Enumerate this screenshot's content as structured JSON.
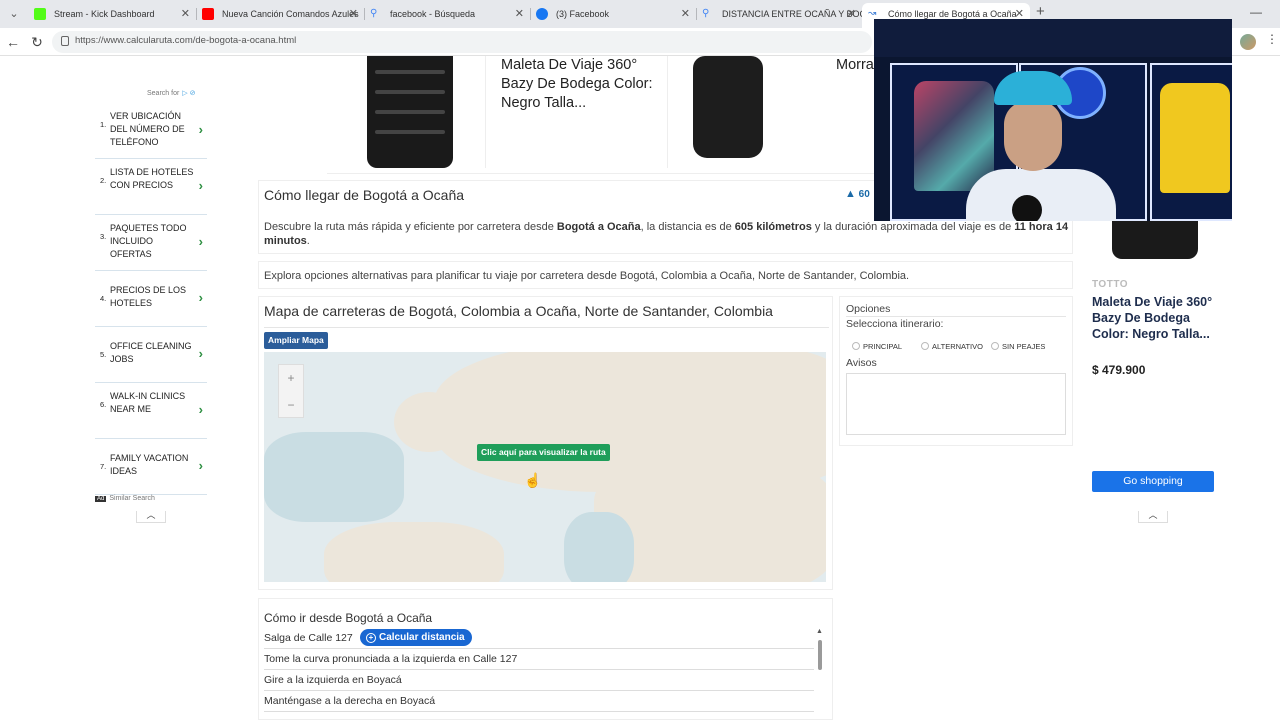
{
  "browser": {
    "tabs": [
      {
        "title": "Stream - Kick Dashboard",
        "icon_color": "#53fc18",
        "active": false
      },
      {
        "title": "Nueva Canción Comandos Azules",
        "icon_color": "#ff0000",
        "active": false
      },
      {
        "title": "facebook - Búsqueda",
        "icon_color": "#4285f4",
        "active": false
      },
      {
        "title": "(3) Facebook",
        "icon_color": "#1877f2",
        "active": false
      },
      {
        "title": "DISTANCIA ENTRE OCAÑA Y BOGOTÁ",
        "icon_color": "#4285f4",
        "active": false
      },
      {
        "title": "Cómo llegar de Bogotá a Ocaña",
        "icon_color": "#3a7bd5",
        "active": true
      }
    ],
    "url": "https://www.calcularuta.com/de-bogota-a-ocana.html"
  },
  "left_ad": {
    "search_for": "Search for",
    "items": [
      {
        "num": "1.",
        "label": "Ver ubicación del número de teléfono"
      },
      {
        "num": "2.",
        "label": "Lista de hoteles con precios"
      },
      {
        "num": "3.",
        "label": "Paquetes todo incluido ofertas"
      },
      {
        "num": "4.",
        "label": "Precios de los hoteles"
      },
      {
        "num": "5.",
        "label": "Office cleaning jobs"
      },
      {
        "num": "6.",
        "label": "Walk-in clinics near me"
      },
      {
        "num": "7.",
        "label": "Family vacation ideas"
      }
    ],
    "footer": "Similar Search",
    "ad_badge": "Ad"
  },
  "top_ads": {
    "product1": "Maleta De Viaje 360° Bazy De Bodega Color: Negro Talla...",
    "product2": "Morra Porta Media"
  },
  "main": {
    "title": "Cómo llegar de Bogotá a Ocaña",
    "distance_badge": "60",
    "desc_pre": "Descubre la ruta más rápida y eficiente por carretera desde ",
    "desc_origin_dest": "Bogotá a Ocaña",
    "desc_mid": ", la distancia es de ",
    "desc_distance": "605 kilómetros",
    "desc_mid2": " y la duración aproximada del viaje es de ",
    "desc_duration": "11 hora 14 minutos",
    "desc_end": ".",
    "alternatives": "Explora opciones alternativas para planificar tu viaje por carretera desde Bogotá, Colombia a Ocaña, Norte de Santander, Colombia.",
    "map_title": "Mapa de carreteras de Bogotá, Colombia a Ocaña, Norte de Santander, Colombia",
    "ampliar_btn": "Ampliar Mapa",
    "map_cta": "Clic aquí para visualizar la ruta"
  },
  "options": {
    "title": "Opciones",
    "select_label": "Selecciona itinerario:",
    "radios": [
      "Principal",
      "Alternativo",
      "Sin peajes"
    ],
    "avisos": "Avisos"
  },
  "route": {
    "title": "Cómo ir desde Bogotá a Ocaña",
    "steps": [
      "Salga de Calle 127",
      "Tome la curva pronunciada a la izquierda en Calle 127",
      "Gire a la izquierda en Boyacá",
      "Manténgase a la derecha en Boyacá"
    ],
    "calc_btn": "Calcular distancia"
  },
  "right_ad": {
    "brand": "TOTTO",
    "title": "Maleta De Viaje 360° Bazy De Bodega Color: Negro Talla...",
    "price": "$ 479.900",
    "cta": "Go shopping"
  },
  "colors": {
    "accent_blue": "#1967d2",
    "cta_green": "#1f9e5a",
    "map_btn_blue": "#2b5d9a",
    "chevron_green": "#2e8f42"
  }
}
